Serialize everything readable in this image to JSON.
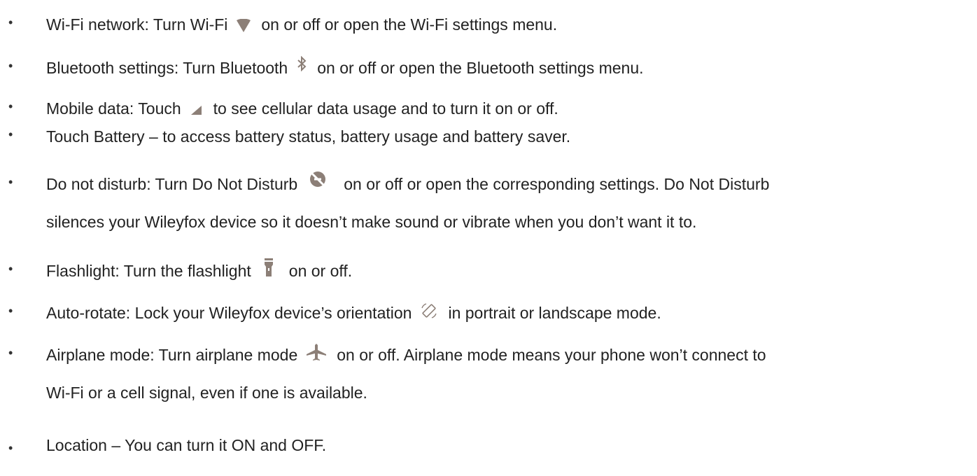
{
  "items": [
    {
      "before": "Wi-Fi network: Turn Wi-Fi",
      "icon": "wifi-icon",
      "after": "on or off or open the Wi-Fi settings menu."
    },
    {
      "before": "Bluetooth settings: Turn Bluetooth",
      "icon": "bluetooth-icon",
      "after": "on or off or open the Bluetooth settings menu."
    },
    {
      "before": "Mobile data: Touch",
      "icon": "cellular-signal-icon",
      "after": "to see cellular data usage and to turn it on or off."
    },
    {
      "text": "Touch Battery – to access battery status, battery usage and battery saver."
    },
    {
      "before": "Do not disturb: Turn Do Not Disturb",
      "icon": "do-not-disturb-icon",
      "after": "on or off or open the corresponding settings. Do Not Disturb",
      "line2": "silences your Wileyfox device so it doesn’t make sound or vibrate when you don’t want it to."
    },
    {
      "before": "Flashlight: Turn the flashlight",
      "icon": "flashlight-icon",
      "after": "on or off."
    },
    {
      "before": "Auto-rotate: Lock your Wileyfox device’s orientation",
      "icon": "auto-rotate-icon",
      "after": "in portrait or landscape mode."
    },
    {
      "before": "Airplane mode: Turn airplane mode",
      "icon": "airplane-icon",
      "after": "on or off. Airplane mode means your phone won’t connect to",
      "line2": "Wi-Fi or a cell signal, even if one is available."
    },
    {
      "text": "Location – You can turn it ON and OFF."
    }
  ],
  "bullet": "•",
  "icon_color": "#8c7f77"
}
